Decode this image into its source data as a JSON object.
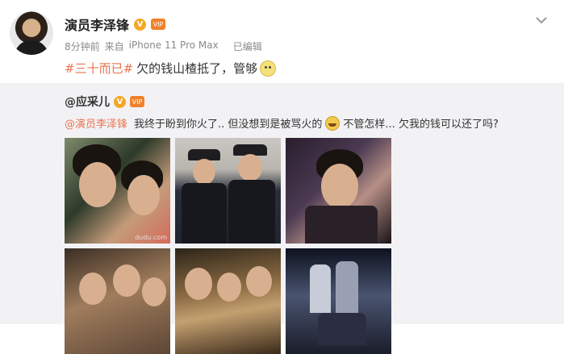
{
  "post": {
    "author": "演员李泽锋",
    "v_badge": "V",
    "vip_badge": "VIP",
    "time": "8分钟前",
    "source_prefix": "来自",
    "source": "iPhone 11 Pro Max",
    "edited": "已编辑",
    "hashtag": "#三十而已#",
    "text": "欠的钱山楂抵了，管够"
  },
  "repost": {
    "author": "@应采儿",
    "v_badge": "V",
    "vip_badge": "VIP",
    "mention": "@演员李泽锋",
    "text_part1": "我终于盼到你火了.. 但没想到是被骂火的",
    "text_part2": "不管怎样... 欠我的钱可以还了吗?",
    "photos": [
      {
        "name": "photo-1",
        "watermark": "dudu.com"
      },
      {
        "name": "photo-2"
      },
      {
        "name": "photo-3"
      },
      {
        "name": "photo-4"
      },
      {
        "name": "photo-5"
      },
      {
        "name": "photo-6"
      }
    ]
  },
  "icons": {
    "avatar": "avatar-icon",
    "verified": "verified-v-icon",
    "vip": "vip-icon",
    "menu": "chevron-down-icon",
    "emoji_post": "cat-face-emoji-icon",
    "emoji_repost": "laughing-emoji-icon"
  },
  "colors": {
    "link": "#eb7350",
    "repost_bg": "#f2f2f5",
    "verified": "#f5a623"
  }
}
